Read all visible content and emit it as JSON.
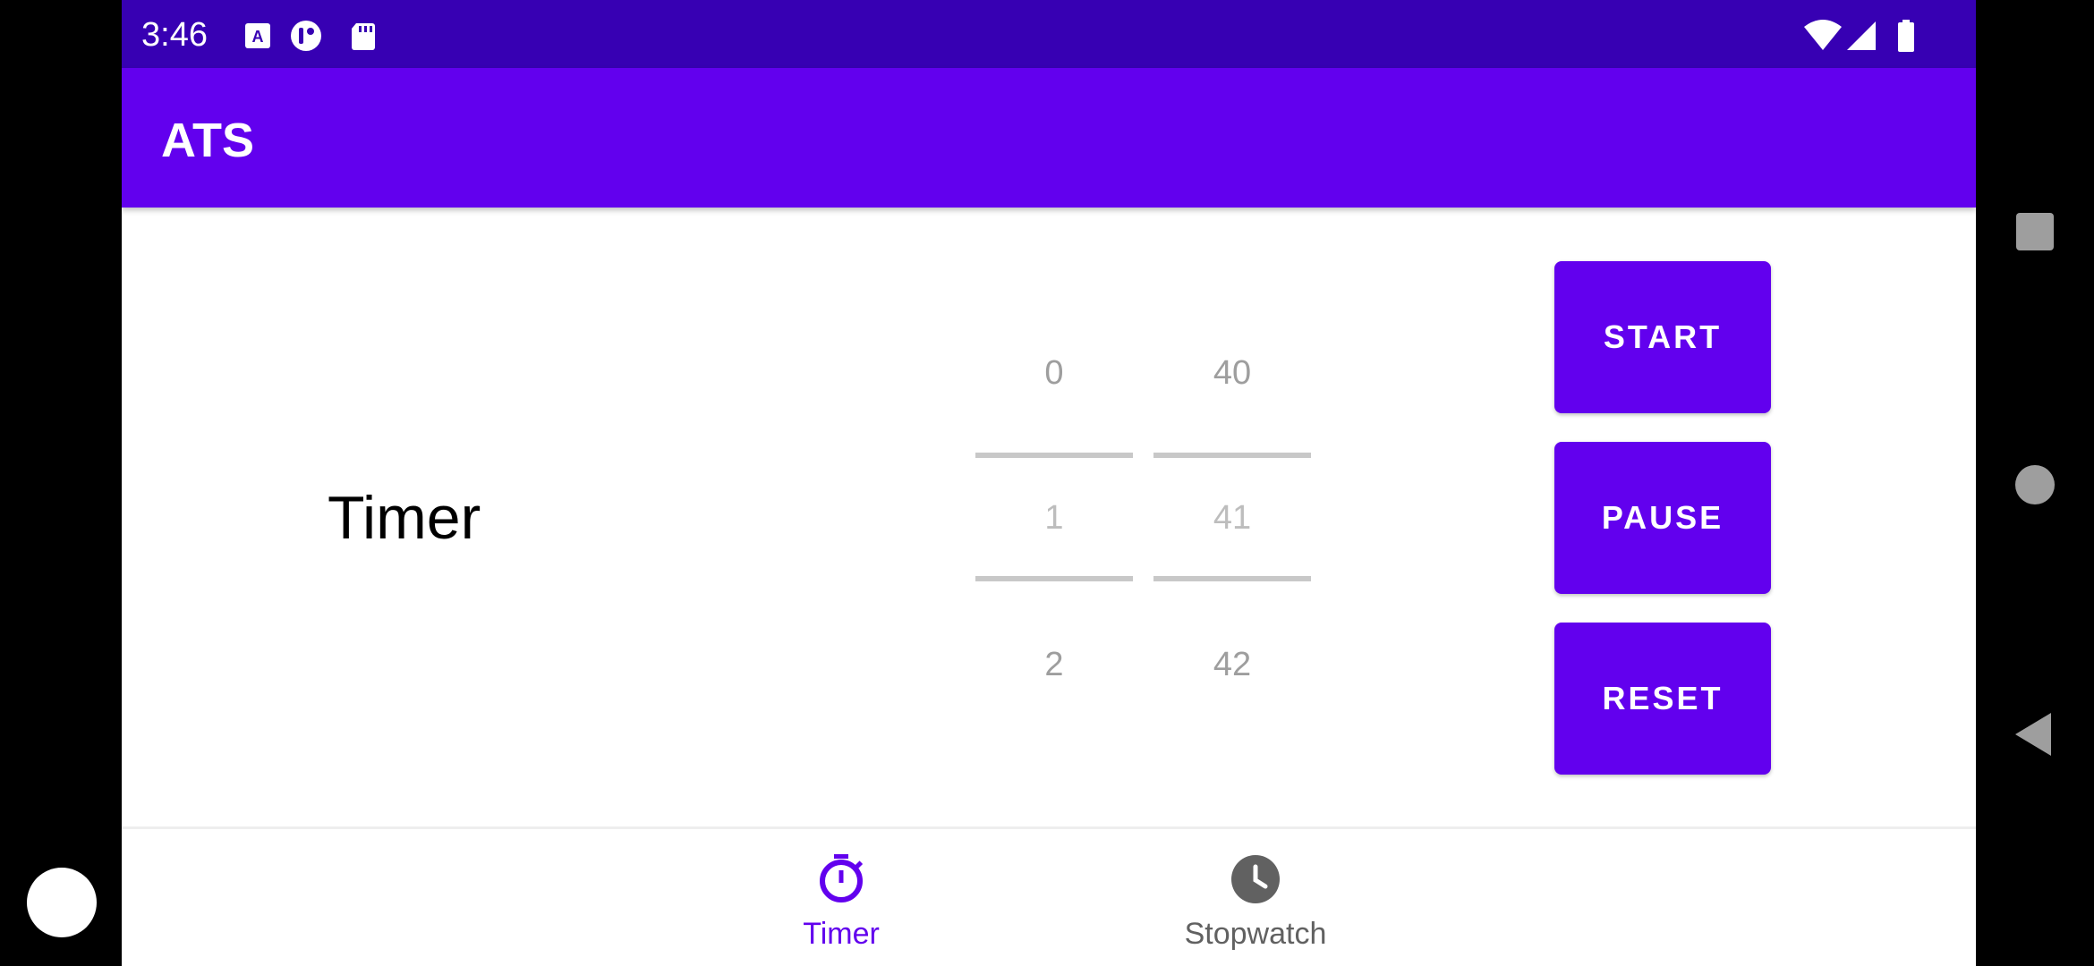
{
  "status_bar": {
    "time": "3:46",
    "left_icons": [
      "text-a-icon",
      "record-icon",
      "sd-card-icon"
    ],
    "right_icons": [
      "wifi-icon",
      "cellular-signal-icon",
      "battery-icon"
    ],
    "color": "#3700b3"
  },
  "app_bar": {
    "title": "ATS",
    "color": "#6200ee"
  },
  "main": {
    "heading": "Timer",
    "minutes_picker": {
      "above": "0",
      "selected": "1",
      "below": "2"
    },
    "seconds_picker": {
      "above": "40",
      "selected": "41",
      "below": "42"
    },
    "buttons": {
      "start": "START",
      "pause": "PAUSE",
      "reset": "RESET"
    }
  },
  "bottom_nav": {
    "items": [
      {
        "label": "Timer",
        "icon": "timer-icon",
        "active": true
      },
      {
        "label": "Stopwatch",
        "icon": "clock-icon",
        "active": false
      }
    ],
    "active_color": "#6200ee",
    "inactive_color": "#616161"
  },
  "system_nav": [
    "recents-square-icon",
    "home-circle-icon",
    "back-triangle-icon"
  ]
}
